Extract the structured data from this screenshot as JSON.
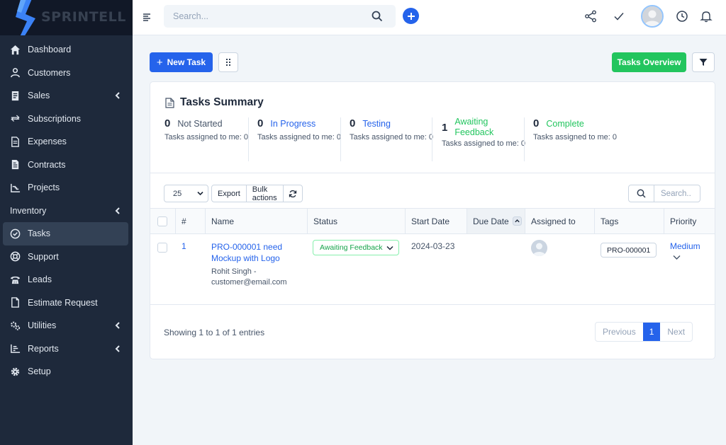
{
  "brand": {
    "name": "SPRINTELL"
  },
  "sidebar": {
    "items": [
      {
        "label": "Dashboard",
        "icon": "home-icon"
      },
      {
        "label": "Customers",
        "icon": "user-icon"
      },
      {
        "label": "Sales",
        "icon": "receipt-icon",
        "chevron": true
      },
      {
        "label": "Subscriptions",
        "icon": "repeat-icon"
      },
      {
        "label": "Expenses",
        "icon": "file-icon"
      },
      {
        "label": "Contracts",
        "icon": "contract-icon"
      },
      {
        "label": "Projects",
        "icon": "chart-icon"
      },
      {
        "label": "Inventory",
        "chevron": true,
        "section": true
      },
      {
        "label": "Tasks",
        "icon": "check-circle-icon",
        "active": true
      },
      {
        "label": "Support",
        "icon": "lifebuoy-icon"
      },
      {
        "label": "Leads",
        "icon": "phone-icon"
      },
      {
        "label": "Estimate Request",
        "icon": "document-icon"
      },
      {
        "label": "Utilities",
        "icon": "cogs-icon",
        "chevron": true
      },
      {
        "label": "Reports",
        "icon": "bar-chart-icon",
        "chevron": true
      },
      {
        "label": "Setup",
        "icon": "gear-icon"
      }
    ]
  },
  "topbar": {
    "search_placeholder": "Search..."
  },
  "actions": {
    "new_task": "New Task",
    "tasks_overview": "Tasks Overview"
  },
  "summary": {
    "title": "Tasks Summary",
    "stats": [
      {
        "count": "0",
        "label": "Not Started",
        "color": "#475569",
        "sub": "Tasks assigned to me: 0"
      },
      {
        "count": "0",
        "label": "In Progress",
        "color": "#2563eb",
        "sub": "Tasks assigned to me: 0"
      },
      {
        "count": "0",
        "label": "Testing",
        "color": "#2563eb",
        "sub": "Tasks assigned to me: 0"
      },
      {
        "count": "1",
        "label": "Awaiting Feedback",
        "color": "#22c55e",
        "sub": "Tasks assigned to me: 0"
      },
      {
        "count": "0",
        "label": "Complete",
        "color": "#22c55e",
        "sub": "Tasks assigned to me: 0"
      }
    ]
  },
  "table": {
    "page_size": "25",
    "export_label": "Export",
    "bulk_label": "Bulk actions",
    "search_placeholder": "Search..",
    "columns": [
      "#",
      "Name",
      "Status",
      "Start Date",
      "Due Date",
      "Assigned to",
      "Tags",
      "Priority"
    ],
    "rows": [
      {
        "id": "1",
        "name": "PRO-000001 need Mockup with Logo",
        "customer": "Rohit Singh - customer@email.com",
        "status": "Awaiting Feedback",
        "start_date": "2024-03-23",
        "due_date": "",
        "tag": "PRO-000001",
        "priority": "Medium"
      }
    ],
    "footer": "Showing 1 to 1 of 1 entries",
    "pager": {
      "prev": "Previous",
      "current": "1",
      "next": "Next"
    }
  }
}
